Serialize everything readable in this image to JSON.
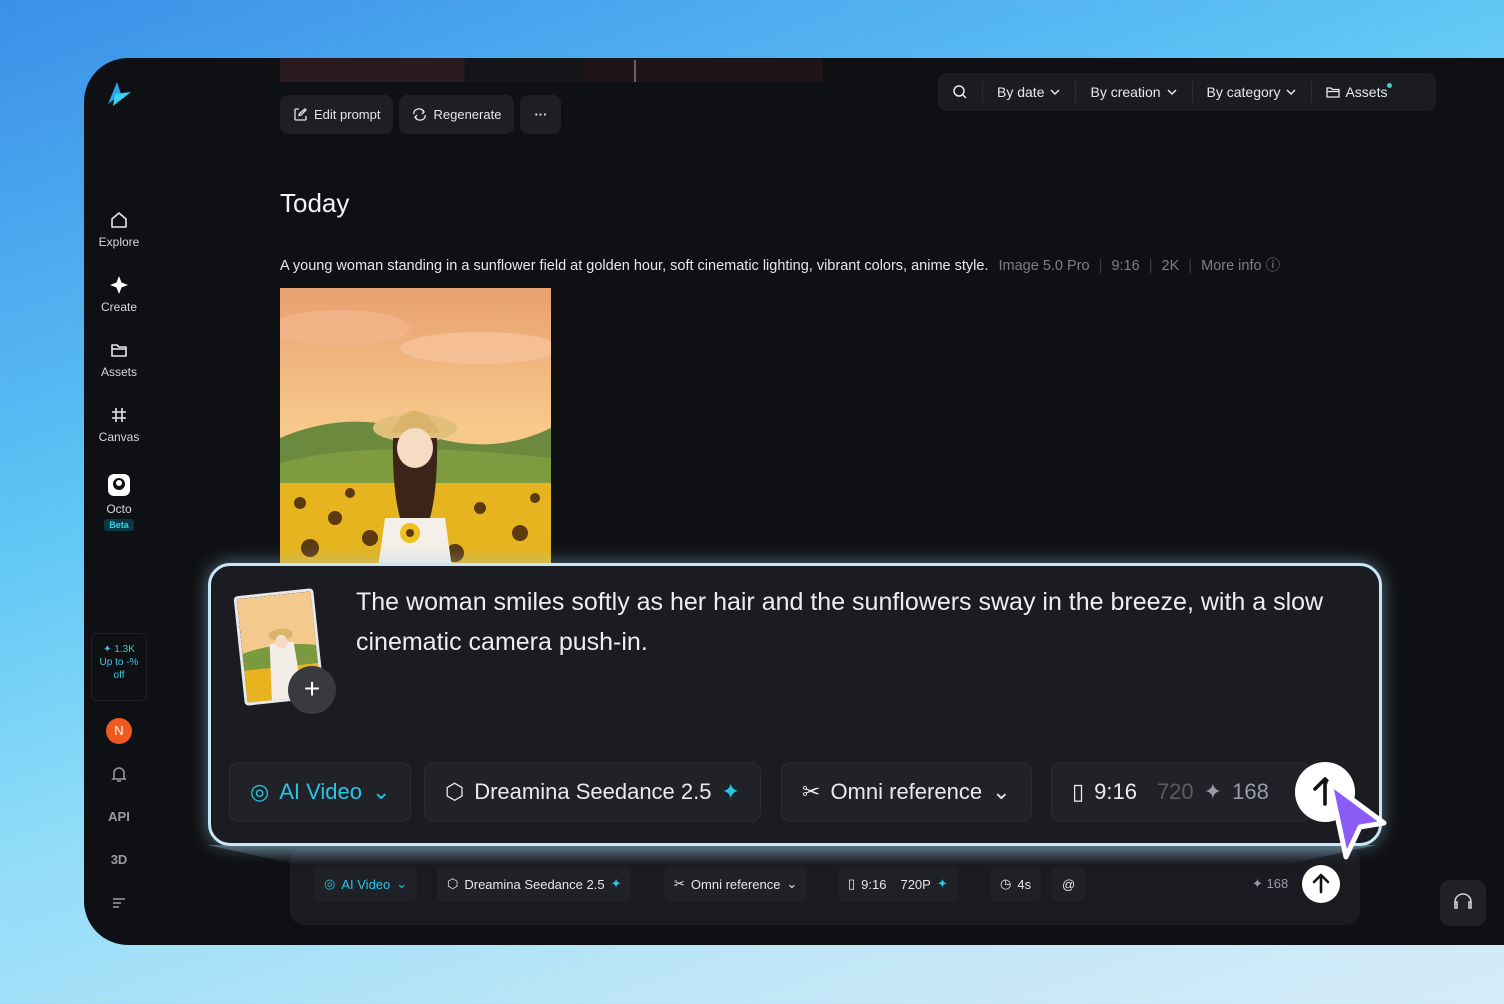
{
  "sidebar": {
    "items": [
      {
        "label": "Explore",
        "icon": "home-icon"
      },
      {
        "label": "Create",
        "icon": "sparkle-icon"
      },
      {
        "label": "Assets",
        "icon": "folder-icon"
      },
      {
        "label": "Canvas",
        "icon": "canvas-icon"
      },
      {
        "label": "Octo",
        "icon": "octo-icon",
        "badge": "Beta"
      }
    ],
    "promo": {
      "credits": "1.3K",
      "line1": "Up to -%",
      "line2": "off"
    },
    "avatar_letter": "N",
    "api_label": "API",
    "three_d_label": "3D"
  },
  "toolbar": {
    "edit_prompt": "Edit prompt",
    "regenerate": "Regenerate",
    "more": "···"
  },
  "filters": {
    "by_date": "By date",
    "by_creation": "By creation",
    "by_category": "By category",
    "assets": "Assets"
  },
  "section": {
    "title": "Today"
  },
  "generation": {
    "prompt": "A young woman standing in a sunflower field at golden hour, soft cinematic lighting, vibrant colors, anime style.",
    "model": "Image 5.0 Pro",
    "ratio": "9:16",
    "resolution": "2K",
    "more_info": "More info"
  },
  "composer": {
    "mode": "AI Video",
    "model": "Dreamina Seedance 2.5",
    "reference": "Omni reference",
    "ratio": "9:16",
    "resolution": "720P",
    "duration": "4s",
    "mention": "@",
    "credits": "168"
  },
  "callout": {
    "prompt_text": "The woman smiles softly as her hair and the sunflowers sway in the breeze, with a slow cinematic camera push-in.",
    "mode": "AI Video",
    "model": "Dreamina Seedance 2.5",
    "reference": "Omni reference",
    "ratio": "9:16",
    "resolution_partial": "720",
    "credits": "168"
  },
  "colors": {
    "accent": "#26c6e4",
    "background": "#0f1013",
    "avatar": "#f05a1e"
  }
}
